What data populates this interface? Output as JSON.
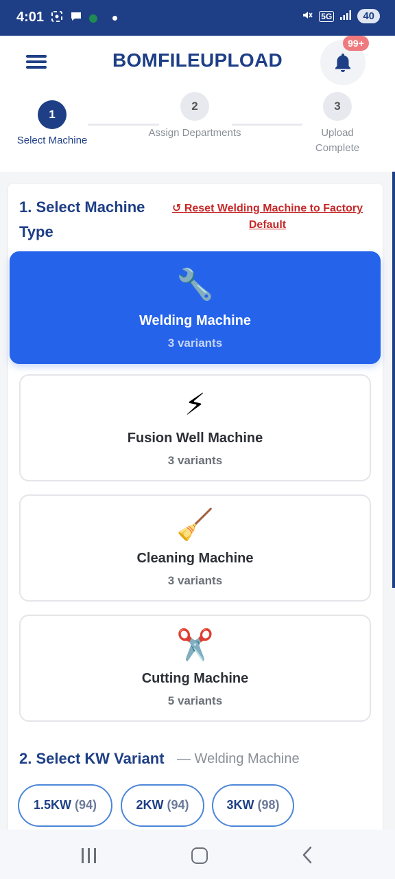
{
  "status_bar": {
    "time": "4:01",
    "battery": "40",
    "network": "5G"
  },
  "header": {
    "title": "BOMFILEUPLOAD",
    "notification_badge": "99+"
  },
  "stepper": {
    "steps": [
      {
        "number": "1",
        "label": "Select Machine",
        "state": "active"
      },
      {
        "number": "2",
        "label": "Assign Departments",
        "state": "inactive"
      },
      {
        "number": "3",
        "label": "Upload Complete",
        "state": "inactive"
      }
    ]
  },
  "section1": {
    "title": "1. Select Machine Type",
    "reset_link": "↺ Reset Welding Machine to Factory Default"
  },
  "machines": [
    {
      "icon": "🔧",
      "icon_name": "wrench-icon",
      "name": "Welding Machine",
      "variants": "3 variants",
      "selected": true
    },
    {
      "icon": "⚡",
      "icon_name": "lightning-icon",
      "name": "Fusion Well Machine",
      "variants": "3 variants",
      "selected": false
    },
    {
      "icon": "🧹",
      "icon_name": "broom-icon",
      "name": "Cleaning Machine",
      "variants": "3 variants",
      "selected": false
    },
    {
      "icon": "✂️",
      "icon_name": "scissors-icon",
      "name": "Cutting Machine",
      "variants": "5 variants",
      "selected": false
    }
  ],
  "section2": {
    "title": "2. Select KW Variant",
    "subtitle": "— Welding Machine"
  },
  "kw_variants": [
    {
      "label": "1.5KW",
      "count": "(94)"
    },
    {
      "label": "2KW",
      "count": "(94)"
    },
    {
      "label": "3KW",
      "count": "(98)"
    }
  ],
  "colors": {
    "primary": "#1e3f86",
    "selected_card": "#2563eb",
    "reset_link": "#c62828",
    "badge": "#ef7a7d"
  }
}
